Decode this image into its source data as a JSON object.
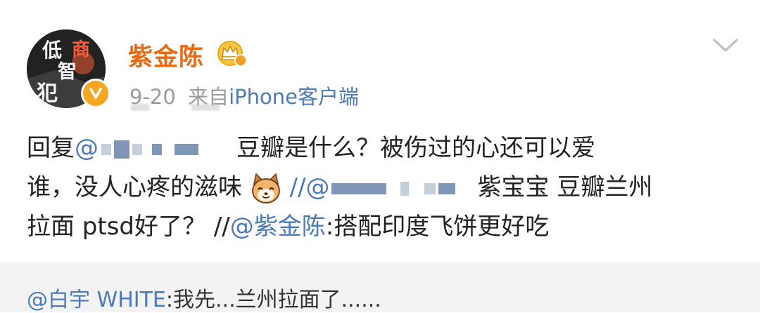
{
  "post": {
    "author": {
      "name": "紫金陈",
      "avatar_title": [
        "低",
        "商",
        "智",
        "犯"
      ],
      "badge": "verified-icon",
      "level_icon": "crown-icon"
    },
    "date": "9-20",
    "source_prefix": "来自",
    "source_client": "iPhone客户端",
    "body": {
      "line1": {
        "reply": "回复",
        "mention_start": "@",
        "tail": "豆瓣是什么？被伤过的心还可以爱"
      },
      "line2": {
        "start": "谁，没人心疼的滋味",
        "repost_marker": "//@",
        "tail": "紫宝宝 豆瓣兰州"
      },
      "line3": {
        "start": "拉面 ptsd好了？ //",
        "mention": "@紫金陈",
        "tail": ":搭配印度飞饼更好吃"
      }
    }
  },
  "repost": {
    "mention": "@白宇 WHITE",
    "text": ":我先...兰州拉面了......"
  },
  "colors": {
    "username": "#e86a11",
    "link": "#4a7ab8",
    "meta": "#9b9b9b",
    "repost_bg": "#f3f3f3"
  }
}
